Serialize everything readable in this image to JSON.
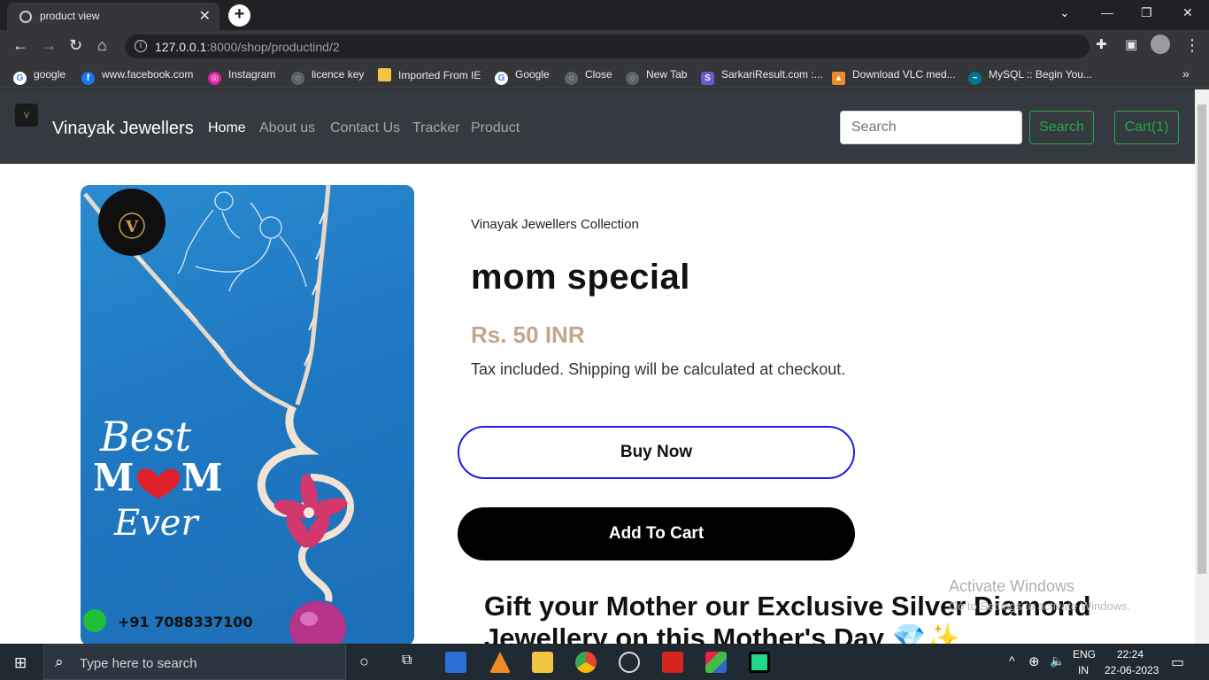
{
  "browser": {
    "tab_title": "product view",
    "url_host": "127.0.0.1",
    "url_rest": ":8000/shop/productind/2",
    "bookmarks": [
      "google",
      "www.facebook.com",
      "Instagram",
      "licence key",
      "Imported From IE",
      "Google",
      "Close",
      "New Tab",
      "SarkariResult.com :...",
      "Download VLC med...",
      "MySQL :: Begin You..."
    ]
  },
  "navbar": {
    "brand": "Vinayak Jewellers",
    "links": [
      "Home",
      "About us",
      "Contact Us",
      "Tracker",
      "Product"
    ],
    "search_placeholder": "Search",
    "search_button": "Search",
    "cart_button": "Cart(1)"
  },
  "product": {
    "collection": "Vinayak Jewellers Collection",
    "title": "mom special",
    "price": "Rs. 50 INR",
    "tax_note": "Tax included. Shipping will be calculated at checkout.",
    "buy_now": "Buy Now",
    "add_to_cart": "Add To Cart",
    "description": "Gift your Mother our Exclusive Silver Diamond Jewellery on this Mother's Day 💎✨",
    "image": {
      "logo_letter": "V",
      "text_best": "Best",
      "text_mom": "M♥M",
      "text_ever": "Ever",
      "phone": "+91 7088337100"
    }
  },
  "windows": {
    "activate_title": "Activate Windows",
    "activate_sub": "Go to Settings to activate Windows.",
    "taskbar_search": "Type here to search",
    "lang_1": "ENG",
    "lang_2": "IN",
    "time": "22:24",
    "date": "22-06-2023"
  }
}
